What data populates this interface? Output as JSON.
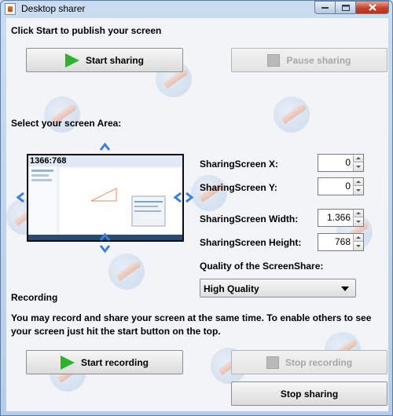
{
  "window": {
    "title": "Desktop sharer",
    "min_icon": "minimize-icon",
    "max_icon": "maximize-icon",
    "close_icon": "close-icon"
  },
  "top": {
    "instruction": "Click Start to publish your screen",
    "start_sharing": "Start sharing",
    "pause_sharing": "Pause sharing"
  },
  "area": {
    "heading": "Select your screen Area:",
    "resolution": "1366:768",
    "icons": {
      "up": "arrow-up-icon",
      "down": "arrow-down-icon",
      "left": "arrow-left-icon",
      "right": "arrow-right-icon"
    }
  },
  "fields": {
    "x": {
      "label": "SharingScreen X:",
      "value": "0"
    },
    "y": {
      "label": "SharingScreen Y:",
      "value": "0"
    },
    "width": {
      "label": "SharingScreen Width:",
      "value": "1.366"
    },
    "height": {
      "label": "SharingScreen Height:",
      "value": "768"
    }
  },
  "quality": {
    "label": "Quality of the ScreenShare:",
    "selected": "High Quality"
  },
  "recording": {
    "heading": "Recording",
    "description": "You may record and share your screen at the same time. To enable others to see your screen just hit the start button on the top.",
    "start": "Start recording",
    "stop": "Stop recording"
  },
  "stop_sharing": "Stop sharing",
  "colors": {
    "play_green": "#2db22d",
    "arrow_blue": "#3a7fd8",
    "close_red": "#c7412b"
  }
}
